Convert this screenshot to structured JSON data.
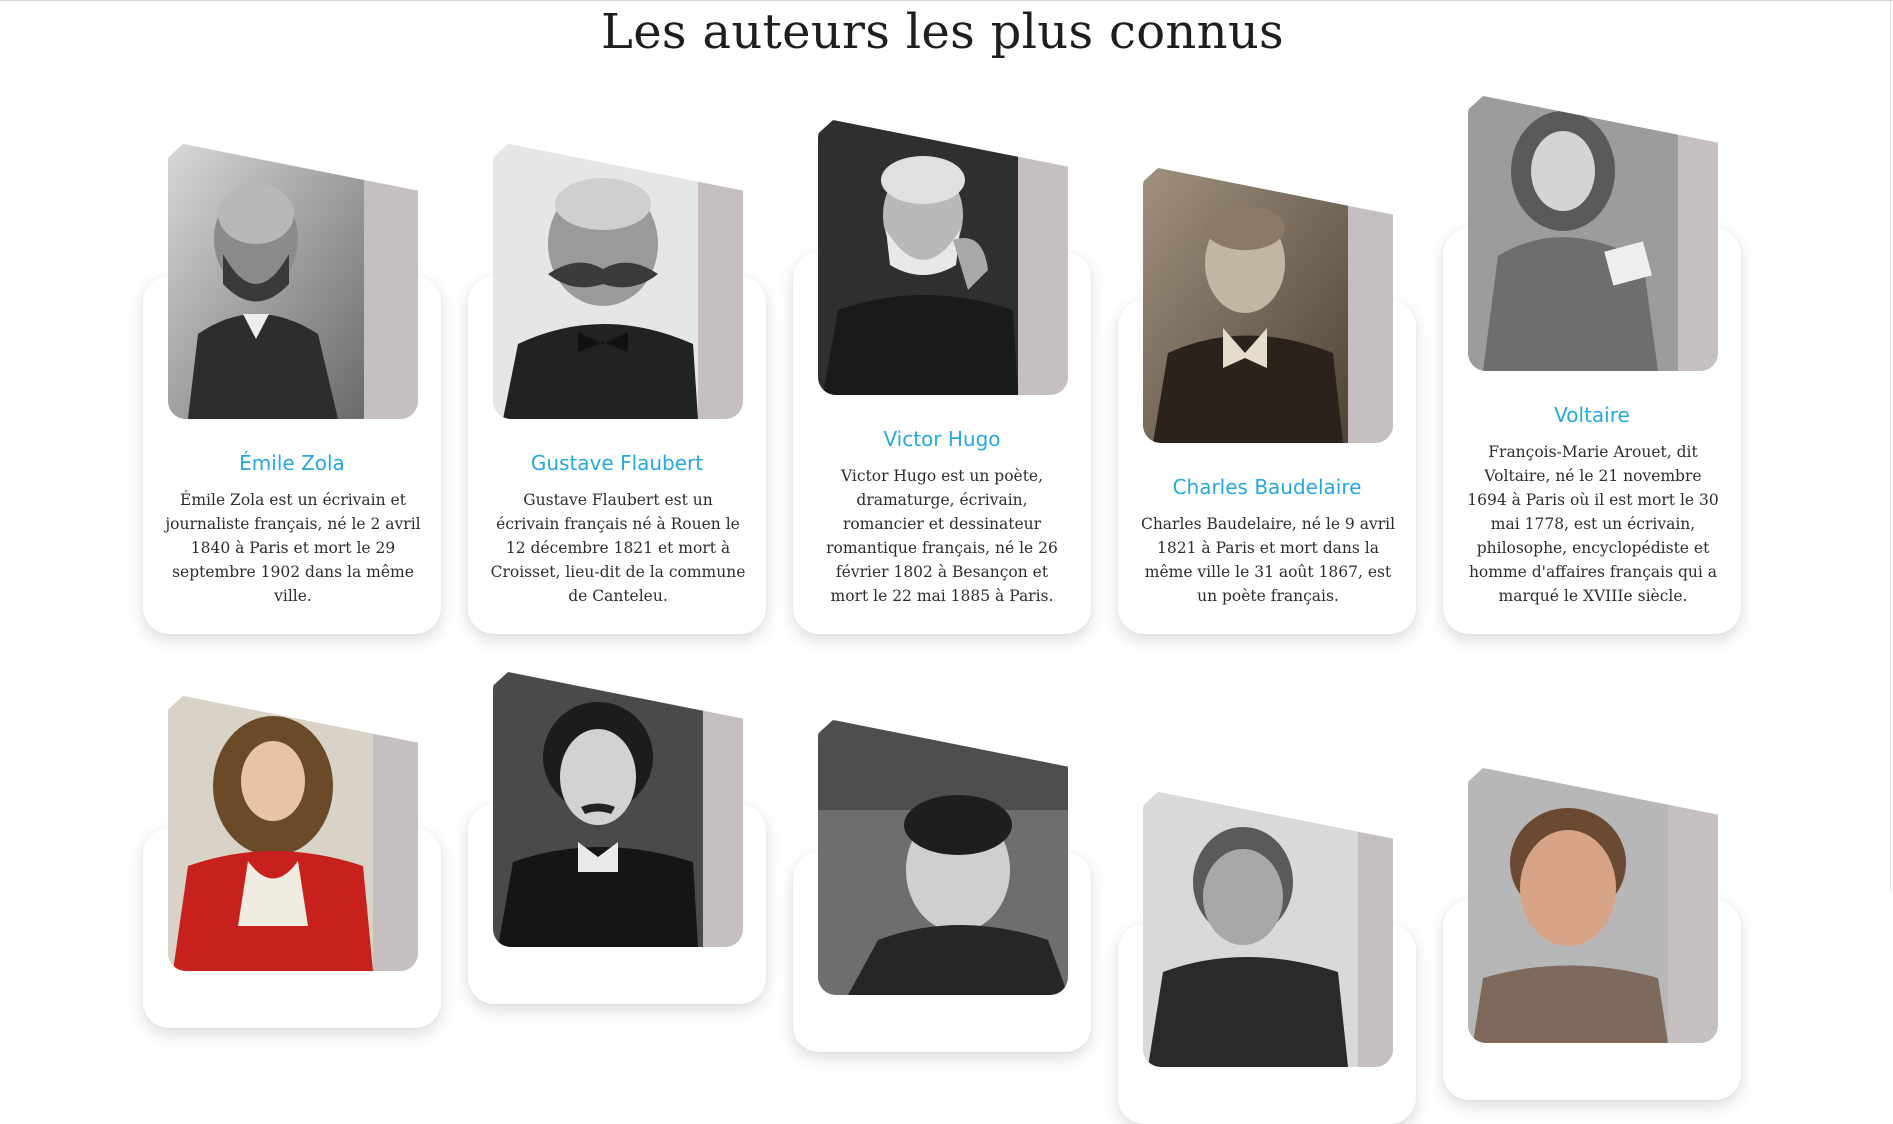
{
  "page": {
    "title": "Les auteurs les plus connus"
  },
  "colors": {
    "accent": "#25a9e0",
    "photo_backdrop": "#c5bfbf",
    "card_background": "#ffffff"
  },
  "authors": [
    {
      "name": "Émile Zola",
      "description": "Émile Zola est un écrivain et journaliste français, né le 2 avril 1840 à Paris et mort le 29 septembre 1902 dans la même ville.",
      "portrait": "black-and-white portrait of a bearded man"
    },
    {
      "name": "Gustave Flaubert",
      "description": "Gustave Flaubert est un écrivain français né à Rouen le 12 décembre 1821 et mort à Croisset, lieu-dit de la commune de Canteleu.",
      "portrait": "black-and-white portrait of a man with large moustache"
    },
    {
      "name": "Victor Hugo",
      "description": "Victor Hugo est un poète, dramaturge, écrivain, romancier et dessinateur romantique français, né le 26 février 1802 à Besançon et mort le 22 mai 1885 à Paris.",
      "portrait": "black-and-white portrait of an old bearded man"
    },
    {
      "name": "Charles Baudelaire",
      "description": "Charles Baudelaire, né le 9 avril 1821 à Paris et mort dans la même ville le 31 août 1867, est un poète français.",
      "portrait": "sepia portrait of a man with bow tie"
    },
    {
      "name": "Voltaire",
      "description": "François-Marie Arouet, dit Voltaire, né le 21 novembre 1694 à Paris où il est mort le 30 mai 1778, est un écrivain, philosophe, encyclopédiste et homme d'affaires français qui a marqué le XVIIIe siècle.",
      "portrait": "grayscale painted portrait of a man in a wig holding a book"
    },
    {
      "portrait": "color painted portrait of a man in red with long curly hair"
    },
    {
      "portrait": "black-and-white portrait of a man with moustache"
    },
    {
      "portrait": "black-and-white portrait of a man with slicked hair"
    },
    {
      "portrait": "black-and-white portrait of a man"
    },
    {
      "portrait": "color photo of a man"
    }
  ]
}
